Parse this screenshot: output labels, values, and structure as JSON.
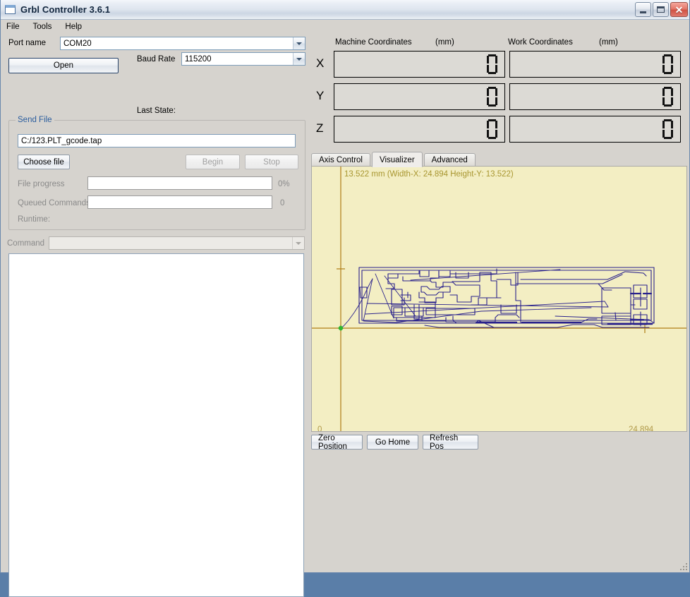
{
  "window": {
    "title": "Grbl Controller 3.6.1",
    "icon": "window-icon",
    "minimize_label": "–",
    "maximize_label": "□",
    "close_label": "✕"
  },
  "menubar": {
    "items": [
      {
        "label": "File"
      },
      {
        "label": "Tools"
      },
      {
        "label": "Help"
      }
    ]
  },
  "connection": {
    "port_label": "Port name",
    "port_value": "COM20",
    "open_button": "Open",
    "baud_label": "Baud Rate",
    "baud_value": "115200",
    "last_state_label": "Last State:",
    "last_state_value": ""
  },
  "send_file": {
    "group_title": "Send File",
    "file_path": "C:/123.PLT_gcode.tap",
    "choose_file_button": "Choose file",
    "begin_button": "Begin",
    "stop_button": "Stop",
    "file_progress_label": "File progress",
    "file_progress_value": "0%",
    "queued_commands_label": "Queued Commands",
    "queued_commands_value": "0",
    "runtime_label": "Runtime:",
    "runtime_value": ""
  },
  "command": {
    "label": "Command",
    "value": ""
  },
  "console": {
    "text": ""
  },
  "coordinates": {
    "machine_header": "Machine Coordinates",
    "machine_units": "(mm)",
    "work_header": "Work Coordinates",
    "work_units": "(mm)",
    "axes": [
      {
        "name": "X",
        "machine": "0",
        "work": "0"
      },
      {
        "name": "Y",
        "machine": "0",
        "work": "0"
      },
      {
        "name": "Z",
        "machine": "0",
        "work": "0"
      }
    ]
  },
  "tabs": [
    {
      "label": "Axis Control",
      "active": false
    },
    {
      "label": "Visualizer",
      "active": true
    },
    {
      "label": "Advanced",
      "active": false
    }
  ],
  "visualizer": {
    "caption": "13.522 mm  (Width-X: 24.894  Height-Y: 13.522)",
    "y_axis_top_label": "13.522",
    "x_origin_label": "0",
    "y_origin_label": "0",
    "x_max_label": "24.894",
    "background_color": "#f3eec3",
    "axis_color": "#b07d14",
    "path_color": "#29218c",
    "origin_marker_color": "#2fb52f",
    "text_color": "#a89630"
  },
  "actions": {
    "zero_position": "Zero Position",
    "go_home": "Go Home",
    "refresh_pos": "Refresh Pos"
  }
}
